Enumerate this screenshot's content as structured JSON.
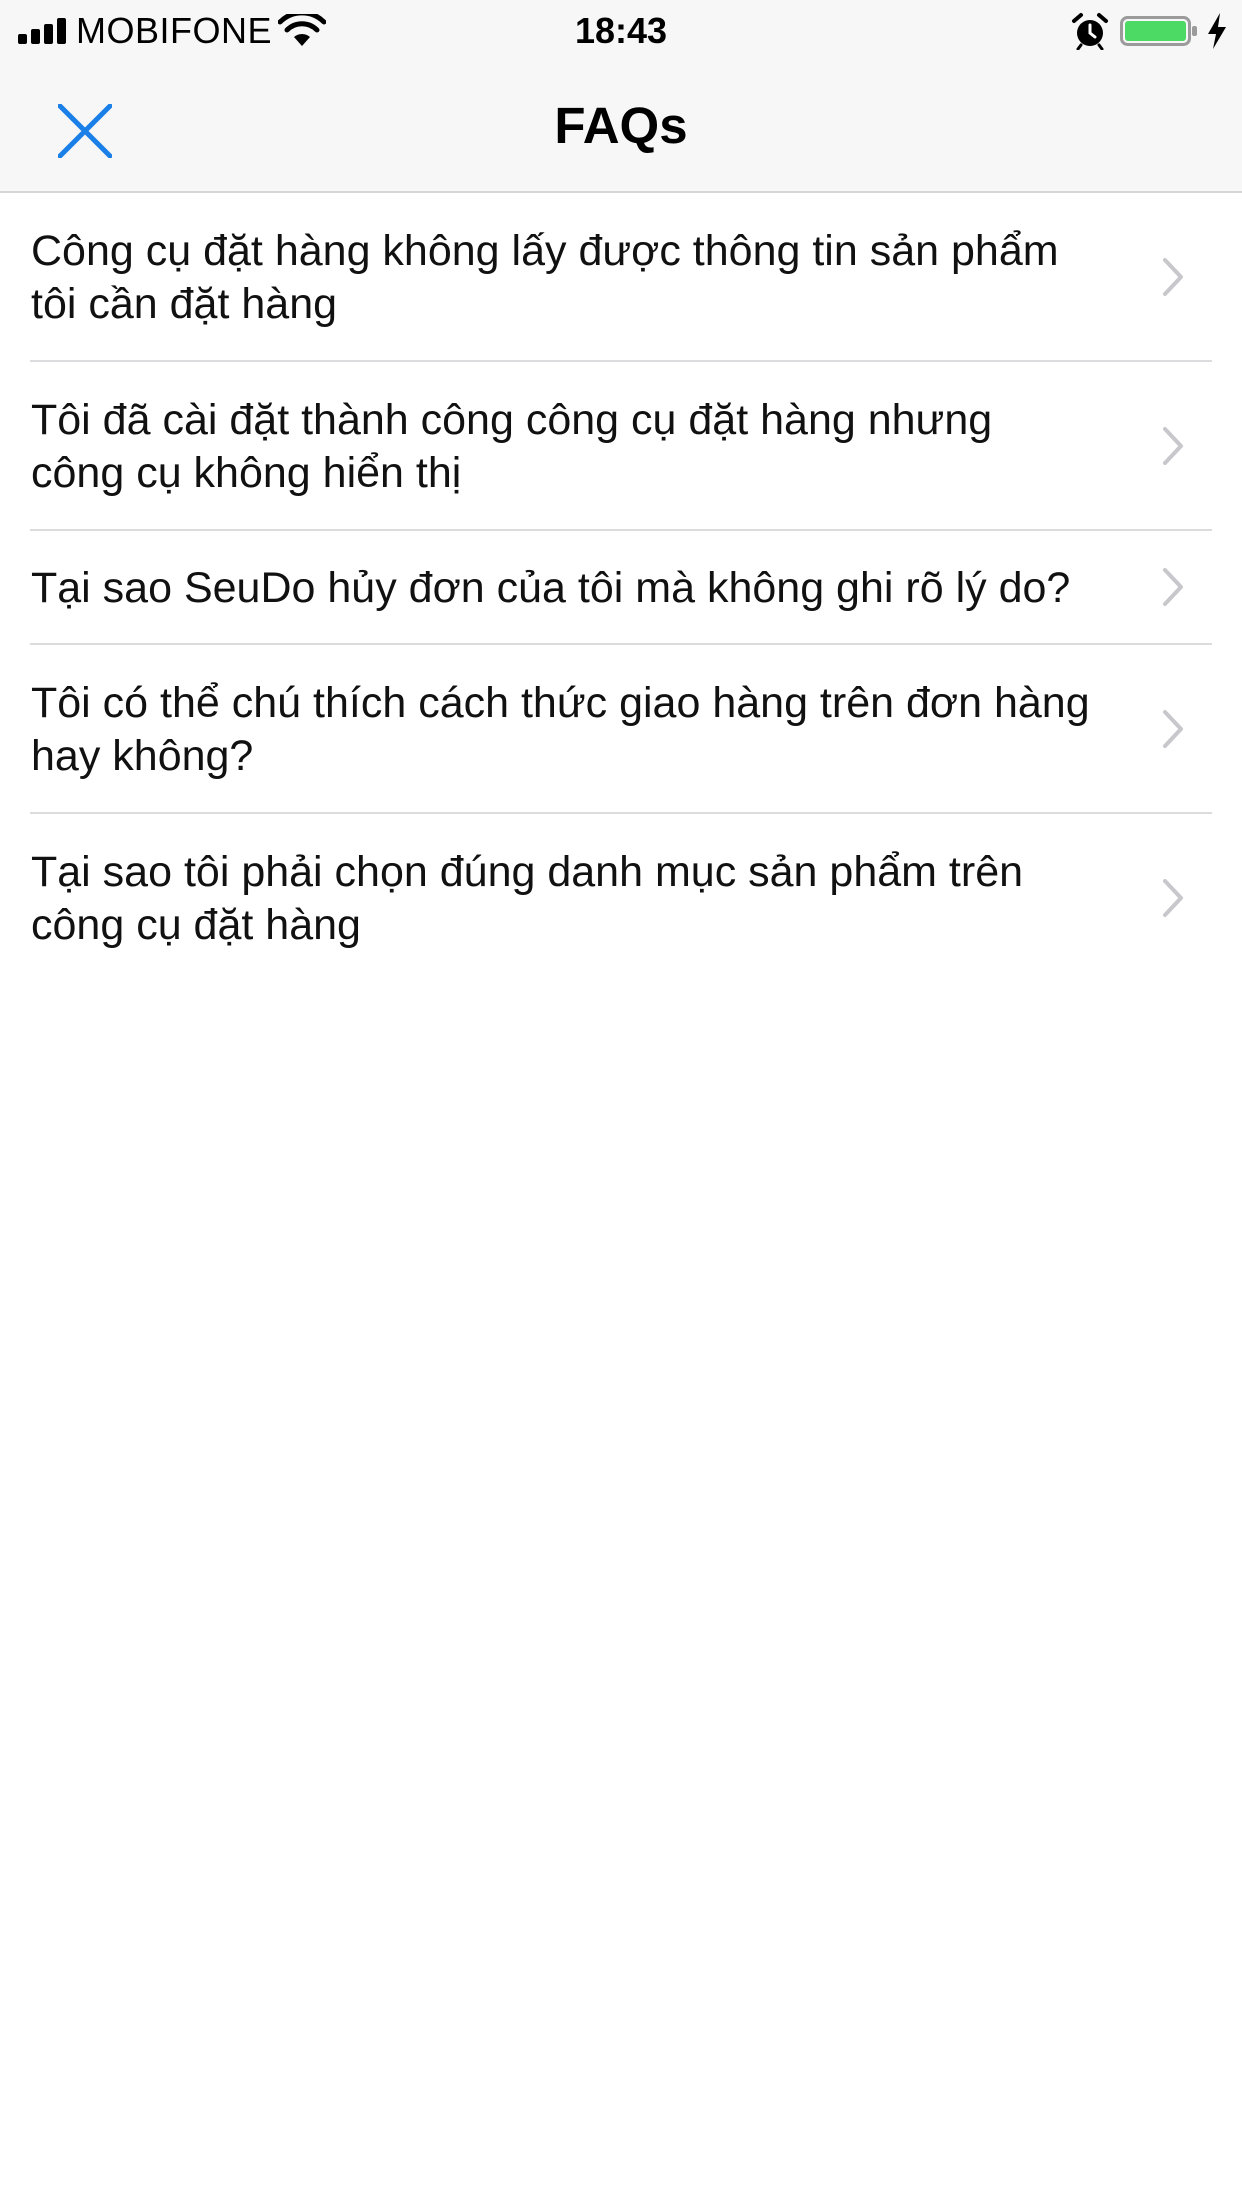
{
  "status_bar": {
    "carrier": "MOBIFONE",
    "time": "18:43",
    "battery_color": "#4cd964",
    "icons": [
      "signal-icon",
      "wifi-icon",
      "alarm-icon",
      "battery-icon",
      "charging-bolt-icon"
    ]
  },
  "nav": {
    "title": "FAQs",
    "close_icon": "close-icon",
    "accent_color": "#1a7fe6"
  },
  "faqs": [
    {
      "question": "Công cụ đặt hàng không lấy được thông tin sản phẩm tôi cần đặt hàng"
    },
    {
      "question": "Tôi đã cài đặt thành công công cụ đặt hàng nhưng công cụ không hiển thị"
    },
    {
      "question": "Tại sao SeuDo hủy đơn của tôi mà không ghi rõ lý do?"
    },
    {
      "question": "Tôi có thể chú thích cách thức giao hàng trên đơn hàng hay không?"
    },
    {
      "question": "Tại sao tôi phải chọn đúng danh mục sản phẩm trên công cụ đặt hàng"
    }
  ],
  "row_icon": "chevron-right-icon"
}
